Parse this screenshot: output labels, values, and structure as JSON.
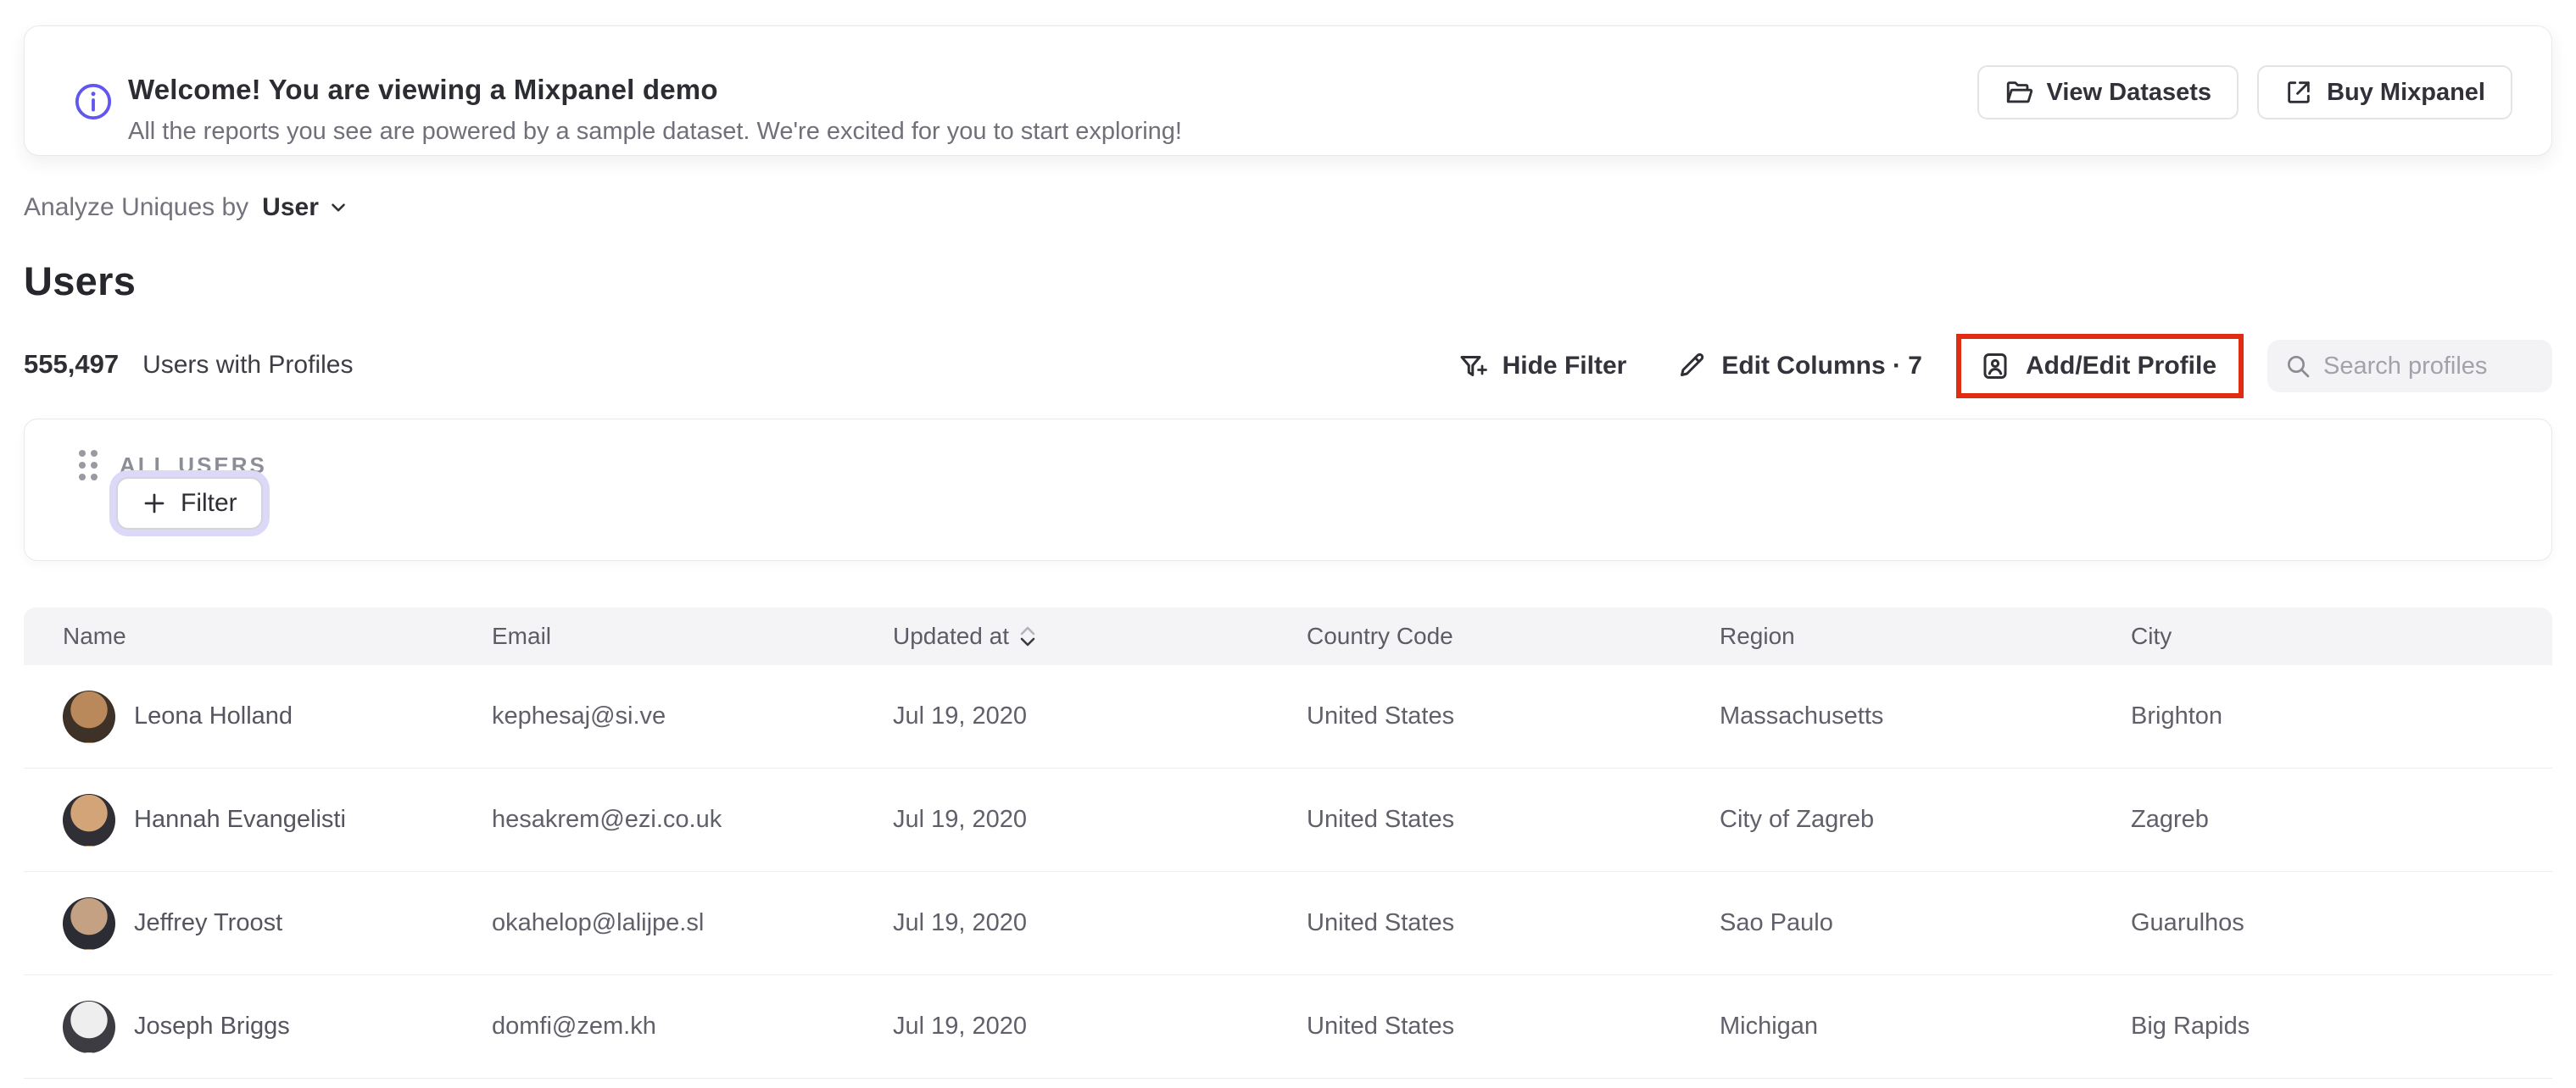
{
  "banner": {
    "title": "Welcome! You are viewing a Mixpanel demo",
    "subtitle": "All the reports you see are powered by a sample dataset. We're excited for you to start exploring!",
    "view_datasets_label": "View Datasets",
    "buy_mixpanel_label": "Buy Mixpanel"
  },
  "controls": {
    "analyze_label": "Analyze Uniques by",
    "analyze_value": "User",
    "page_title": "Users",
    "count": "555,497",
    "count_label": "Users with Profiles",
    "hide_filter_label": "Hide Filter",
    "edit_columns_label": "Edit Columns · 7",
    "add_edit_profile_label": "Add/Edit Profile",
    "search_placeholder": "Search profiles"
  },
  "filter_panel": {
    "group_label": "ALL USERS",
    "add_filter_label": "Filter"
  },
  "table": {
    "columns": [
      "Name",
      "Email",
      "Updated at",
      "Country Code",
      "Region",
      "City"
    ],
    "sorted_column": "Updated at",
    "sort_direction": "descending",
    "rows": [
      {
        "name": "Leona Holland",
        "email": "kephesaj@si.ve",
        "updated_at": "Jul 19, 2020",
        "country_code": "United States",
        "region": "Massachusetts",
        "city": "Brighton",
        "avatar_colors": [
          "#b9895c",
          "#3d3128"
        ]
      },
      {
        "name": "Hannah Evangelisti",
        "email": "hesakrem@ezi.co.uk",
        "updated_at": "Jul 19, 2020",
        "country_code": "United States",
        "region": "City of Zagreb",
        "city": "Zagreb",
        "avatar_colors": [
          "#d2a478",
          "#2f2f35"
        ]
      },
      {
        "name": "Jeffrey Troost",
        "email": "okahelop@lalijpe.sl",
        "updated_at": "Jul 19, 2020",
        "country_code": "United States",
        "region": "Sao Paulo",
        "city": "Guarulhos",
        "avatar_colors": [
          "#c4a183",
          "#2c2c34"
        ]
      },
      {
        "name": "Joseph Briggs",
        "email": "domfi@zem.kh",
        "updated_at": "Jul 19, 2020",
        "country_code": "United States",
        "region": "Michigan",
        "city": "Big Rapids",
        "avatar_colors": [
          "#efeeef",
          "#3c3c42"
        ]
      }
    ]
  },
  "colors": {
    "accent_purple": "#6157f0",
    "annotation_red": "#e02c10",
    "filter_ring": "#dbd8f8"
  }
}
